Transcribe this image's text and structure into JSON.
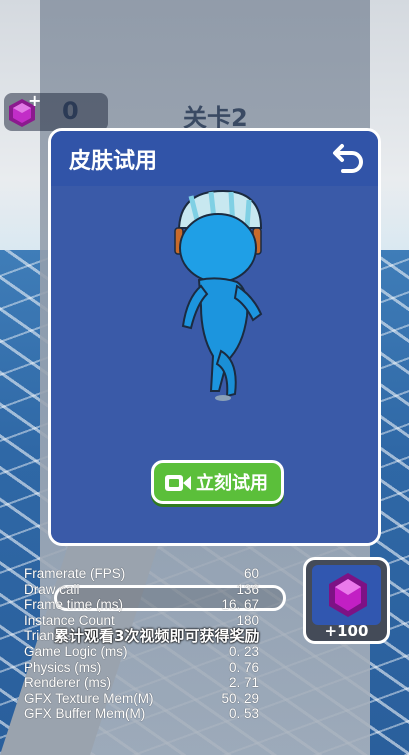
{
  "hud": {
    "gem_count": "0",
    "level": "关卡2"
  },
  "dialog": {
    "title": "皮肤试用",
    "try_button_label": "立刻试用"
  },
  "reward": {
    "amount": "+100"
  },
  "tip": "累计观看3次视频即可获得奖励",
  "stats": [
    {
      "name": "Framerate (FPS)",
      "value": "60"
    },
    {
      "name": "Draw call",
      "value": "136"
    },
    {
      "name": "Frame time (ms)",
      "value": "16. 67"
    },
    {
      "name": "Instance Count",
      "value": "180"
    },
    {
      "name": "Triangle",
      "value": ""
    },
    {
      "name": "Game Logic (ms)",
      "value": "0. 23"
    },
    {
      "name": "Physics (ms)",
      "value": "0. 76"
    },
    {
      "name": "Renderer (ms)",
      "value": "2. 71"
    },
    {
      "name": "GFX Texture Mem(M)",
      "value": "50. 29"
    },
    {
      "name": "GFX Buffer Mem(M)",
      "value": "0. 53"
    }
  ],
  "colors": {
    "dialog_bg": "#3a5aa8",
    "button_green": "#5bbf3a",
    "gem_magenta": "#c21fc4"
  }
}
